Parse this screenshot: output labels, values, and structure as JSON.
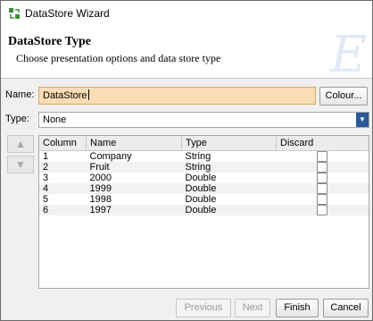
{
  "window": {
    "title": "DataStore Wizard"
  },
  "header": {
    "title": "DataStore Type",
    "subtitle": "Choose presentation options and data store type",
    "watermark": "E"
  },
  "form": {
    "name_label": "Name:",
    "name_value": "DataStore",
    "colour_button": "Colour...",
    "type_label": "Type:",
    "type_value": "None"
  },
  "side_buttons": {
    "up": "▲",
    "down": "▼"
  },
  "table": {
    "columns": [
      "Column",
      "Name",
      "Type",
      "Discard"
    ],
    "rows": [
      {
        "column": "1",
        "name": "Company",
        "type": "String",
        "discard": false
      },
      {
        "column": "2",
        "name": "Fruit",
        "type": "String",
        "discard": false
      },
      {
        "column": "3",
        "name": "2000",
        "type": "Double",
        "discard": false
      },
      {
        "column": "4",
        "name": "1999",
        "type": "Double",
        "discard": false
      },
      {
        "column": "5",
        "name": "1998",
        "type": "Double",
        "discard": false
      },
      {
        "column": "6",
        "name": "1997",
        "type": "Double",
        "discard": false
      }
    ]
  },
  "footer": {
    "previous": "Previous",
    "next": "Next",
    "finish": "Finish",
    "cancel": "Cancel"
  }
}
